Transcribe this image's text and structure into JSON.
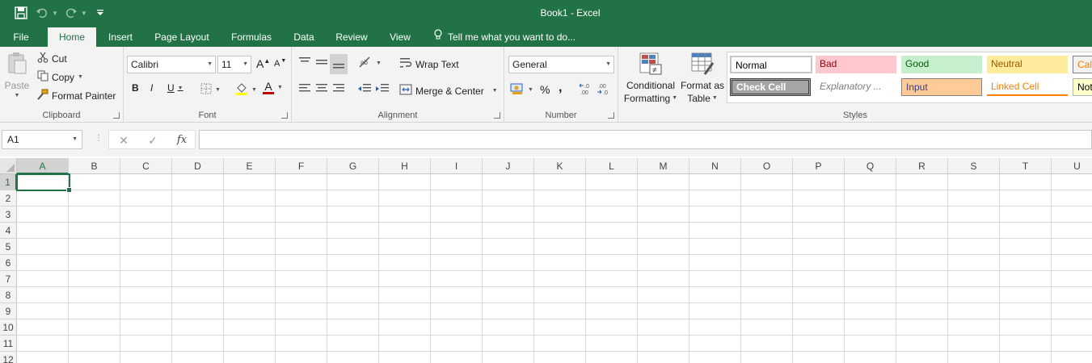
{
  "window": {
    "title": "Book1 - Excel"
  },
  "tabs": [
    {
      "label": "File"
    },
    {
      "label": "Home"
    },
    {
      "label": "Insert"
    },
    {
      "label": "Page Layout"
    },
    {
      "label": "Formulas"
    },
    {
      "label": "Data"
    },
    {
      "label": "Review"
    },
    {
      "label": "View"
    }
  ],
  "tell_me": "Tell me what you want to do...",
  "clipboard": {
    "paste": "Paste",
    "cut": "Cut",
    "copy": "Copy",
    "format_painter": "Format Painter",
    "label": "Clipboard"
  },
  "font": {
    "family": "Calibri",
    "size": "11",
    "label": "Font",
    "bold": "B",
    "italic": "I",
    "underline": "U",
    "grow": "A",
    "shrink": "A",
    "font_color_letter": "A",
    "fill_color": "#ffff00",
    "text_color": "#c00000"
  },
  "alignment": {
    "wrap": "Wrap Text",
    "merge": "Merge & Center",
    "label": "Alignment"
  },
  "number": {
    "format": "General",
    "percent": "%",
    "comma": ",",
    "label": "Number"
  },
  "conditional": {
    "line1": "Conditional",
    "line2": "Formatting"
  },
  "format_table": {
    "line1": "Format as",
    "line2": "Table"
  },
  "styles": {
    "label": "Styles",
    "cells": [
      {
        "text": "Normal"
      },
      {
        "text": "Bad"
      },
      {
        "text": "Good"
      },
      {
        "text": "Neutral"
      },
      {
        "text": "Calc"
      },
      {
        "text": "Check Cell"
      },
      {
        "text": "Explanatory ..."
      },
      {
        "text": "Input"
      },
      {
        "text": "Linked Cell"
      },
      {
        "text": "Not"
      }
    ]
  },
  "formula_bar": {
    "name_box": "A1",
    "fx": "fx",
    "cancel": "✕",
    "enter": "✓"
  },
  "grid": {
    "columns": [
      "A",
      "B",
      "C",
      "D",
      "E",
      "F",
      "G",
      "H",
      "I",
      "J",
      "K",
      "L",
      "M",
      "N",
      "O",
      "P",
      "Q",
      "R",
      "S",
      "T",
      "U"
    ],
    "rows": [
      "1",
      "2",
      "3",
      "4",
      "5",
      "6",
      "7",
      "8",
      "9",
      "10",
      "11",
      "12"
    ],
    "selected": "A1"
  },
  "icons": {
    "save": "save-icon",
    "undo": "undo-icon",
    "redo": "redo-icon",
    "tellme": "lightbulb-icon"
  }
}
